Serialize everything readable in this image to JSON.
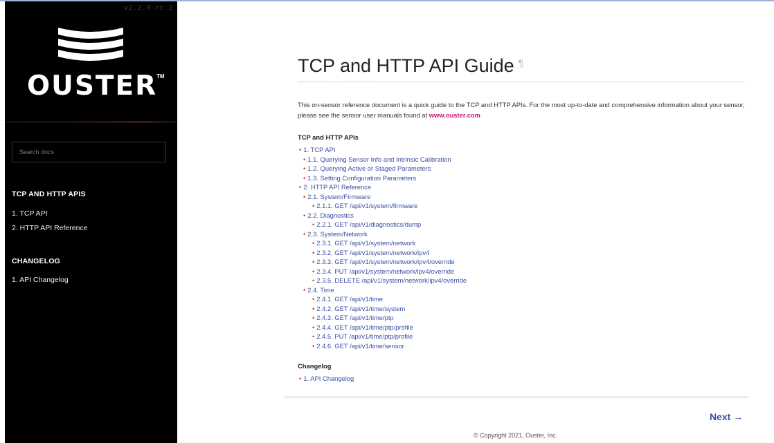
{
  "sidebar": {
    "version": "v2.2.0-rc.2",
    "logo_text": "OUSTER",
    "logo_tm": "TM",
    "search_placeholder": "Search docs",
    "sections": [
      {
        "caption": "TCP AND HTTP APIS",
        "items": [
          "1. TCP API",
          "2. HTTP API Reference"
        ]
      },
      {
        "caption": "CHANGELOG",
        "items": [
          "1. API Changelog"
        ]
      }
    ]
  },
  "main": {
    "title": "TCP and HTTP API Guide",
    "pilcrow": "¶",
    "intro_text": "This on-sensor reference document is a quick guide to the TCP and HTTP APIs. For the most up-to-date and comprehensive information about your sensor, please see the sensor user manuals found at",
    "intro_link": "www.ouster.com",
    "toc_heading": "TCP and HTTP APIs",
    "toc": [
      {
        "level": 1,
        "label": "1. TCP API"
      },
      {
        "level": 2,
        "label": "1.1. Querying Sensor Info and Intrinsic Calibration"
      },
      {
        "level": 2,
        "label": "1.2. Querying Active or Staged Parameters"
      },
      {
        "level": 2,
        "label": "1.3. Setting Configuration Parameters"
      },
      {
        "level": 1,
        "label": "2. HTTP API Reference"
      },
      {
        "level": 2,
        "label": "2.1. System/Firmware"
      },
      {
        "level": 3,
        "label": "2.1.1. GET /api/v1/system/firmware"
      },
      {
        "level": 2,
        "label": "2.2. Diagnostics"
      },
      {
        "level": 3,
        "label": "2.2.1. GET /api/v1/diagnostics/dump"
      },
      {
        "level": 2,
        "label": "2.3. System/Network"
      },
      {
        "level": 3,
        "label": "2.3.1. GET /api/v1/system/network"
      },
      {
        "level": 3,
        "label": "2.3.2. GET /api/v1/system/network/ipv4"
      },
      {
        "level": 3,
        "label": "2.3.3. GET /api/v1/system/network/ipv4/override"
      },
      {
        "level": 3,
        "label": "2.3.4. PUT /api/v1/system/network/ipv4/override"
      },
      {
        "level": 3,
        "label": "2.3.5. DELETE /api/v1/system/network/ipv4/override"
      },
      {
        "level": 2,
        "label": "2.4. Time"
      },
      {
        "level": 3,
        "label": "2.4.1. GET /api/v1/time"
      },
      {
        "level": 3,
        "label": "2.4.2. GET /api/v1/time/system"
      },
      {
        "level": 3,
        "label": "2.4.3. GET /api/v1/time/ptp"
      },
      {
        "level": 3,
        "label": "2.4.4. GET /api/v1/time/ptp/profile"
      },
      {
        "level": 3,
        "label": "2.4.5. PUT /api/v1/time/ptp/profile"
      },
      {
        "level": 3,
        "label": "2.4.6. GET /api/v1/time/sensor"
      }
    ],
    "changelog_heading": "Changelog",
    "changelog": [
      "1. API Changelog"
    ],
    "next_label": "Next →",
    "copyright": "© Copyright 2021, Ouster, Inc."
  },
  "colors": {
    "sidebar_bg": "#000000",
    "link": "#3a4ea4",
    "accent_link": "#c8167d",
    "bullet": "#d12a2a"
  },
  "icons": [
    "ouster-logo-icon",
    "pilcrow-icon",
    "arrow-right-icon"
  ]
}
